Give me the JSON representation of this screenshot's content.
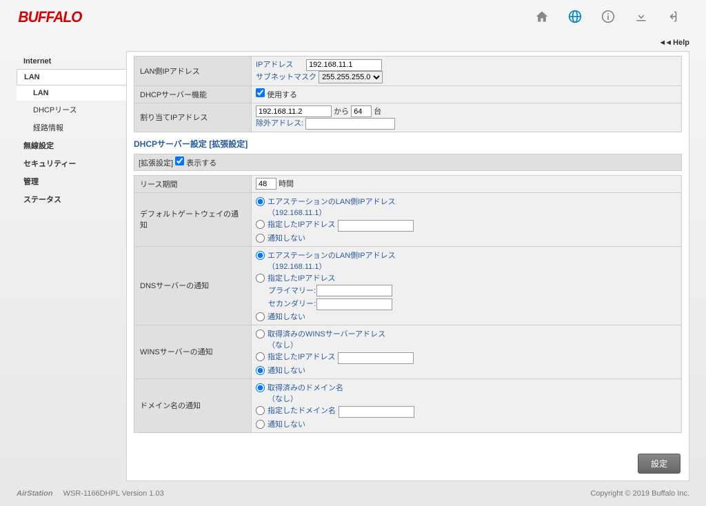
{
  "header": {
    "logo": "BUFFALO"
  },
  "help": {
    "arrows": "◄◄",
    "label": "Help"
  },
  "sidebar": {
    "internet": "Internet",
    "lan": "LAN",
    "lan_sub": "LAN",
    "dhcp_lease": "DHCPリース",
    "route": "経路情報",
    "wireless": "無線設定",
    "security": "セキュリティー",
    "admin": "管理",
    "status": "ステータス"
  },
  "lan": {
    "row_label": "LAN側IPアドレス",
    "ip_label": "IPアドレス",
    "ip_value": "192.168.11.1",
    "subnet_label": "サブネットマスク",
    "subnet_value": "255.255.255.0"
  },
  "dhcp": {
    "row_label": "DHCPサーバー機能",
    "use_label": "使用する"
  },
  "assign": {
    "row_label": "割り当てIPアドレス",
    "start_ip": "192.168.11.2",
    "from": "から",
    "count": "64",
    "units": "台",
    "exclude_label": "除外アドレス:",
    "exclude_value": ""
  },
  "ext": {
    "section": "DHCPサーバー設定 [拡張設定]",
    "row_label": "[拡張設定]",
    "show_label": "表示する"
  },
  "lease": {
    "row_label": "リース期間",
    "value": "48",
    "unit": "時間"
  },
  "gateway": {
    "row_label": "デフォルトゲートウェイの通知",
    "opt1": "エアステーションのLAN側IPアドレス",
    "opt1_sub": "（192.168.11.1）",
    "opt2": "指定したIPアドレス",
    "opt2_value": "",
    "opt3": "通知しない"
  },
  "dns": {
    "row_label": "DNSサーバーの通知",
    "opt1": "エアステーションのLAN側IPアドレス",
    "opt1_sub": "（192.168.11.1）",
    "opt2": "指定したIPアドレス",
    "primary_label": "プライマリー:",
    "primary_value": "",
    "secondary_label": "セカンダリー:",
    "secondary_value": "",
    "opt3": "通知しない"
  },
  "wins": {
    "row_label": "WINSサーバーの通知",
    "opt1": "取得済みのWINSサーバーアドレス",
    "opt1_sub": "（なし）",
    "opt2": "指定したIPアドレス",
    "opt2_value": "",
    "opt3": "通知しない"
  },
  "domain": {
    "row_label": "ドメイン名の通知",
    "opt1": "取得済みのドメイン名",
    "opt1_sub": "（なし）",
    "opt2": "指定したドメイン名",
    "opt2_value": "",
    "opt3": "通知しない"
  },
  "button": {
    "apply": "設定"
  },
  "footer": {
    "brand": "AirStation",
    "version": "WSR-1166DHPL Version 1.03",
    "copyright": "Copyright © 2019 Buffalo Inc."
  }
}
